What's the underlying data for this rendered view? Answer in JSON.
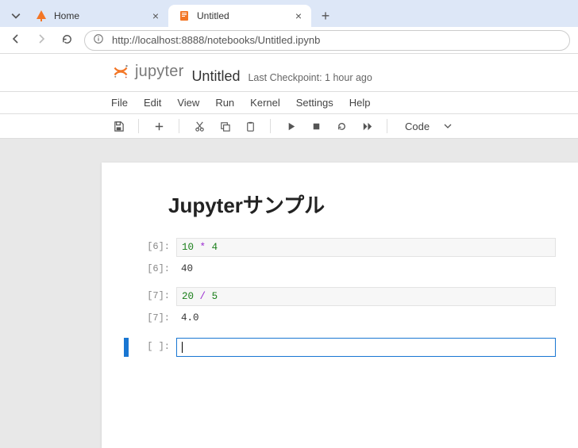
{
  "browser": {
    "tabs": [
      {
        "title": "Home",
        "active": false
      },
      {
        "title": "Untitled",
        "active": true
      }
    ],
    "url": "http://localhost:8888/notebooks/Untitled.ipynb"
  },
  "jupyter": {
    "logo": "jupyter",
    "title": "Untitled",
    "checkpoint": "Last Checkpoint: 1 hour ago",
    "menus": [
      "File",
      "Edit",
      "View",
      "Run",
      "Kernel",
      "Settings",
      "Help"
    ],
    "cell_format": "Code"
  },
  "notebook": {
    "heading": "Jupyterサンプル",
    "cells": [
      {
        "kind": "in",
        "n": "6",
        "prompt": "[6]:",
        "tokens": {
          "a": "10",
          "op": "*",
          "b": "4"
        }
      },
      {
        "kind": "out",
        "n": "6",
        "prompt": "[6]:",
        "text": "40"
      },
      {
        "kind": "in",
        "n": "7",
        "prompt": "[7]:",
        "tokens": {
          "a": "20",
          "op": "/",
          "b": "5"
        }
      },
      {
        "kind": "out",
        "n": "7",
        "prompt": "[7]:",
        "text": "4.0"
      },
      {
        "kind": "empty",
        "prompt": "[ ]:"
      }
    ]
  }
}
